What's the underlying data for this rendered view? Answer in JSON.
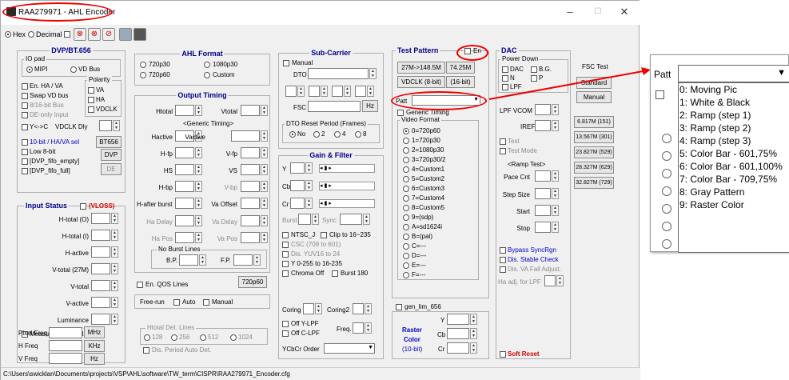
{
  "window": {
    "title": "RAA279971 - AHL Encoder",
    "min": "–",
    "max": "☐",
    "close": "✕"
  },
  "toolbar": {
    "hex": "Hex",
    "decimal": "Decimal"
  },
  "dvp": {
    "title": "DVP/BT.656",
    "io_pad": "IO pad",
    "mipi": "MIPI",
    "vd_bus": "VD Bus",
    "polarity": "Polarity",
    "en_ha_va": "En. HA / VA",
    "swap_vd_bus": "Swap VD bus",
    "va": "VA",
    "ha": "HA",
    "vdclk": "VDCLK",
    "bus_8_16": "8/16-bit Bus",
    "de_only": "DE-only Input",
    "y_c": "Y<->C",
    "vdclk_dly": "VDCLK Dly",
    "ten_bit": "10-bit / HA/VA sel",
    "bt656": "BT656",
    "low8": "Low 8-bit",
    "dvp_btn": "DVP",
    "fifo_empty": "[DVP_fifo_empty]",
    "fifo_full": "[DVP_fifo_full]",
    "de_btn": "DE"
  },
  "input_status": {
    "title": "Input Status",
    "vloss": "(VLOSS)",
    "labels": [
      "H-total (O)",
      "H-total (I)",
      "H-active",
      "V-total (27M)",
      "V-total",
      "V-active",
      "Luminance"
    ],
    "measure": "Measure Clock Sel.",
    "pixel_freq": "Pixel Freq",
    "h_freq": "H Freq",
    "v_freq": "V Freq",
    "mhz": "MHz",
    "khz": "KHz",
    "hz": "Hz"
  },
  "ahl": {
    "title": "AHL Format",
    "opts": [
      "720p30",
      "1080p30",
      "720p60",
      "Custom"
    ]
  },
  "output_timing": {
    "title": "Output Timing",
    "htotal": "Htotal",
    "vtotal": "Vtotal",
    "generic": "<Generic Timing>",
    "hactive": "Hactive",
    "vactive": "Vactive",
    "hfp": "H-fp",
    "vfp": "V-fp",
    "hs": "HS",
    "vs": "VS",
    "hbp": "H-bp",
    "vbp": "V-bp",
    "hafter": "H-after burst",
    "vaoffset": "Va Offset",
    "hadelay": "Ha Delay",
    "vadelay": "Va Delay",
    "hapos": "Ha Pos",
    "vapos": "Va Pos",
    "noburst": "No Burst Lines",
    "bp": "B.P.",
    "fp": "F.P.",
    "qos": "En. QOS Lines",
    "p720": "720p60",
    "freerun": "Free-run",
    "auto": "Auto",
    "manual": "Manual",
    "hdet": "Htotal Det. Lines",
    "hdet_opts": [
      "128",
      "256",
      "512",
      "1024"
    ],
    "period": "Dis. Period Auto Det."
  },
  "subcarrier": {
    "title": "Sub-Carrier",
    "manual": "Manual",
    "dto": "DTO",
    "fsc": "FSC",
    "hz": "Hz",
    "dto_reset": "DTO Reset Period (Frames)",
    "dto_opts": [
      "No",
      "2",
      "4",
      "8"
    ]
  },
  "gain": {
    "title": "Gain & Filter",
    "y": "Y",
    "cb": "Cb",
    "cr": "Cr",
    "burst": "Burst",
    "sync": "Sync",
    "ntsc_j": "NTSC_J",
    "clip": "Clip to 16~235",
    "csc": "CSC (709 to 601)",
    "dis_yuv": "Dis. YUV16 to 24",
    "y0255": "Y 0-255 to 16-235",
    "chroma_off": "Chroma Off",
    "burst180": "Burst 180",
    "coring": "Coring",
    "coring2": "Coring2",
    "off_ylpf": "Off Y-LPF",
    "off_clpf": "Off C-LPF",
    "freq": "Freq.",
    "ycbcr": "YCbCr Order"
  },
  "test": {
    "title": "Test Pattern",
    "en": "En",
    "f1": "27M->148.5M",
    "f2": "74.25M",
    "f3": "VDCLK (8-bit)",
    "f4": "(16-bit)",
    "patt": "Patt",
    "generic": "Generic Timing",
    "video_format": "Video Format",
    "formats": [
      "0=720p60",
      "1=720p30",
      "2=1080p30",
      "3=720p30/2",
      "4=Custom1",
      "5=Custom2",
      "6=Custom3",
      "7=Custom4",
      "8=Custom5",
      "9=(sdp)",
      "A=sd1624i",
      "B=(pal)",
      "C=---",
      "D=---",
      "E=---",
      "F=---"
    ],
    "gen_lim": "gen_lim_656",
    "raster": "Raster",
    "color": "Color",
    "bit10": "(10-bit)",
    "y": "Y",
    "cb": "Cb",
    "cr": "Cr"
  },
  "dac": {
    "title": "DAC",
    "power_down": "Power Down",
    "dac": "DAC",
    "bg": "B.G.",
    "n": "N",
    "p": "P",
    "lpf": "LPF",
    "vcom": "LPF VCOM",
    "iref": "IREF",
    "test": "Test",
    "test_mode": "Test Mode",
    "ramp": "<Ramp Test>",
    "pace": "Pace Cnt",
    "step": "Step Size",
    "start": "Start",
    "stop": "Stop",
    "bypass": "Bypass SyncRgn",
    "dis_stable": "Dis. Stable Check",
    "dis_va": "Dis. VA Fall Adjust.",
    "ha_adj": "Ha adj. for LPF",
    "soft_reset": "Soft Reset"
  },
  "fsc_test": {
    "title": "FSC Test",
    "standard": "Standard",
    "manual": "Manual",
    "freqs": [
      "6.817M (151)",
      "13.567M (301)",
      "23.827M (529)",
      "28.327M (629)",
      "32.827M (729)"
    ]
  },
  "status_bar": "C:\\Users\\swicklan\\Documents\\projects\\VSP\\AHL\\software\\TW_term\\CISPR\\RAA279971_Encoder.cfg",
  "popup": {
    "patt": "Patt",
    "items": [
      "0: Moving Pic",
      "1: White & Black",
      "2: Ramp (step 1)",
      "3: Ramp (step 2)",
      "4: Ramp (step 3)",
      "5: Color Bar - 601,75%",
      "6: Color Bar - 601,100%",
      "7: Color Bar - 709,75%",
      "8: Gray Pattern",
      "9: Raster Color"
    ]
  },
  "colors": {
    "accent_title": "#00008b",
    "highlight": "#e00000"
  }
}
